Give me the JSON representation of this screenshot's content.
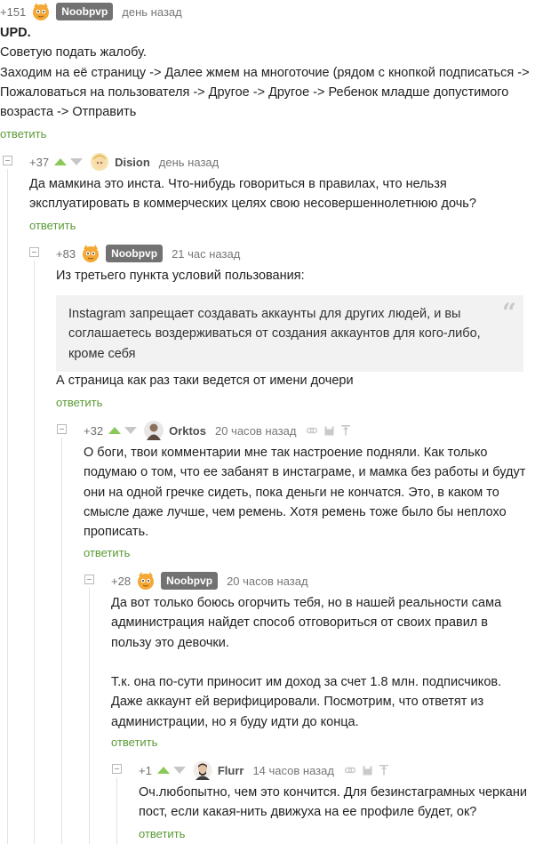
{
  "comments": [
    {
      "rating": "+151",
      "author": "Noobpvp",
      "time": "день назад",
      "lines": [
        "UPD.",
        "Советую подать жалобу.",
        "Заходим на её страницу -> Далее жмем на многоточие (рядом с кнопкой подписаться ->",
        "Пожаловаться на пользователя -> Другое -> Другое -> Ребенок младше допустимого",
        "возраста -> Отправить"
      ],
      "reply": "ответить"
    },
    {
      "rating": "+37",
      "author": "Dision",
      "time": "день назад",
      "lines": [
        "Да мамкина это инста. Что-нибудь говориться в правилах, что нельзя",
        "эксплуатировать в коммерческих целях свою несовершеннолетнюю дочь?"
      ],
      "reply": "ответить"
    },
    {
      "rating": "+83",
      "author": "Noobpvp",
      "time": "21 час назад",
      "intro": "Из третьего пункта условий пользования:",
      "quote": [
        "Instagram запрещает создавать аккаунты для других людей, и вы",
        "соглашаетесь воздерживаться от создания аккаунтов для кого-либо,",
        "кроме себя"
      ],
      "outro": "А страница как раз таки ведется от имени дочери",
      "reply": "ответить"
    },
    {
      "rating": "+32",
      "author": "Orktos",
      "time": "20 часов назад",
      "lines": [
        "О боги, твои комментарии мне так настроение подняли. Как только",
        "подумаю о том, что ее забанят в инстаграме, и мамка без работы и будут",
        "они на одной гречке сидеть, пока деньги не кончатся. Это, в каком то",
        "смысле даже лучше, чем ремень. Хотя ремень тоже было бы неплохо",
        "прописать."
      ],
      "reply": "ответить"
    },
    {
      "rating": "+28",
      "author": "Noobpvp",
      "time": "20 часов назад",
      "lines": [
        "Да вот только боюсь огорчить тебя, но в нашей реальности сама",
        "администрация найдет способ отговориться от своих правил в",
        "пользу это девочки.",
        "",
        "Т.к. она по-сути приносит им доход за счет 1.8 млн. подписчиков.",
        "Даже аккаунт ей верифицировали. Посмотрим, что ответят из",
        "администрации, но я буду идти до конца."
      ],
      "reply": "ответить"
    },
    {
      "rating": "+1",
      "author": "Flurr",
      "time": "14 часов назад",
      "lines": [
        "Оч.любопытно, чем это кончится. Для безинстаграмных черкани",
        "пост, если какая-нить движуха на ее профиле будет, ок?"
      ],
      "reply": "ответить"
    }
  ],
  "icons": [
    "link-icon",
    "save-icon",
    "pin-icon",
    "quote-icon",
    "collapse-icon",
    "upvote-icon",
    "downvote-icon"
  ],
  "colors": {
    "accent": "#5a9a35",
    "upvote": "#8ac858",
    "badge": "#727272",
    "quote_bg": "#f2f2f2"
  }
}
